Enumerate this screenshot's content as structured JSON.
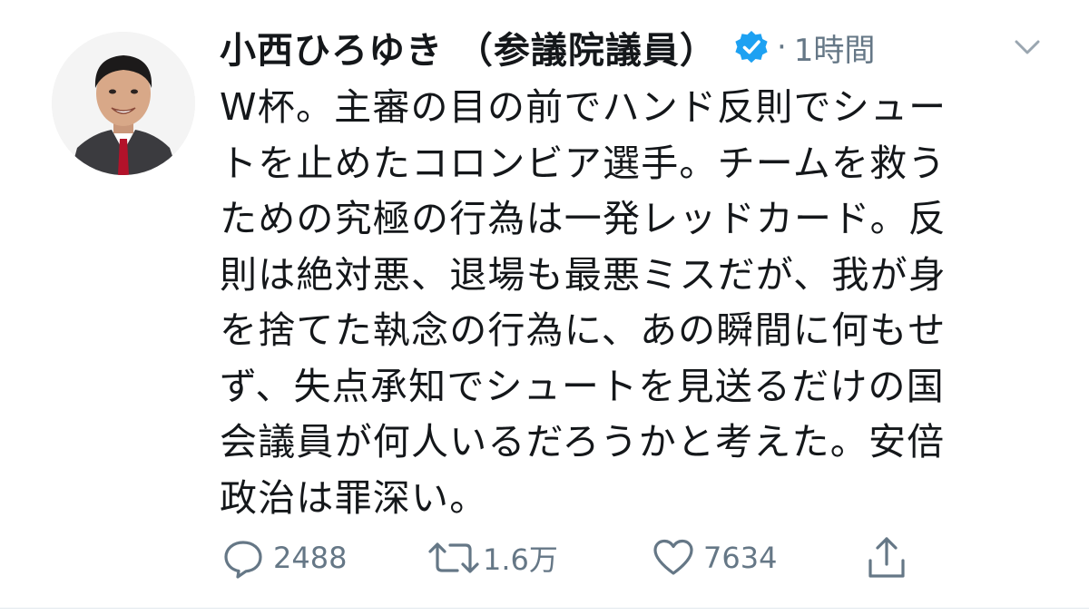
{
  "author": {
    "display_name": "小西ひろゆき （参議院議員）",
    "verified_icon": "verified-badge-icon",
    "separator": "·",
    "timestamp": "1時間"
  },
  "menu": {
    "icon": "chevron-down-icon"
  },
  "tweet": {
    "text": "W杯。主審の目の前でハンド反則でシュー\nトを止めたコロンビア選手。チームを救う\nための究極の行為は一発レッドカード。反\n則は絶対悪、退場も最悪ミスだが、我が身\nを捨てた執念の行為に、あの瞬間に何もせ\nず、失点承知でシュートを見送るだけの国\n会議員が何人いるだろうかと考えた。安倍\n政治は罪深い。"
  },
  "actions": {
    "reply": {
      "icon": "reply-icon",
      "count": "2488"
    },
    "retweet": {
      "icon": "retweet-icon",
      "count": "1.6万"
    },
    "like": {
      "icon": "heart-icon",
      "count": "7634"
    },
    "share": {
      "icon": "share-icon"
    }
  },
  "colors": {
    "text": "#14171a",
    "muted": "#657786",
    "verified": "#1da1f2",
    "divider": "#e1e8ed"
  }
}
